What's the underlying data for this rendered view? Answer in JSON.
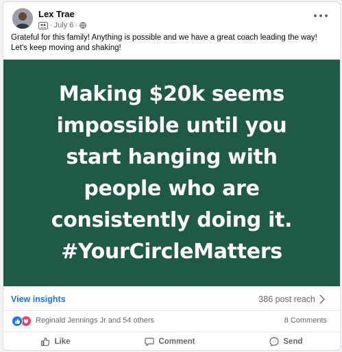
{
  "post": {
    "author": "Lex Trae",
    "date": "July 6",
    "separator": "·",
    "caption": "Grateful for this family! Anything is possible and we have a great coach leading the way! Let's keep moving and shaking!",
    "image_text": "Making $20k seems\nimpossible until you\nstart hanging with\npeople who are\nconsistently doing it.\n#YourCircleMatters",
    "image_bg_color": "#1f5948"
  },
  "insights": {
    "view_label": "View insights",
    "reach": "386 post reach"
  },
  "engagement": {
    "reacted_by": "Reginald Jennings Jr and 54 others",
    "comments": "8 Comments",
    "reaction_icons": [
      "like-icon",
      "love-icon"
    ]
  },
  "actions": {
    "like": "Like",
    "comment": "Comment",
    "send": "Send"
  },
  "colors": {
    "link_blue": "#1b74e4",
    "like_blue": "#1877f2",
    "love_red": "#f33e58",
    "secondary_text": "#65676b"
  }
}
